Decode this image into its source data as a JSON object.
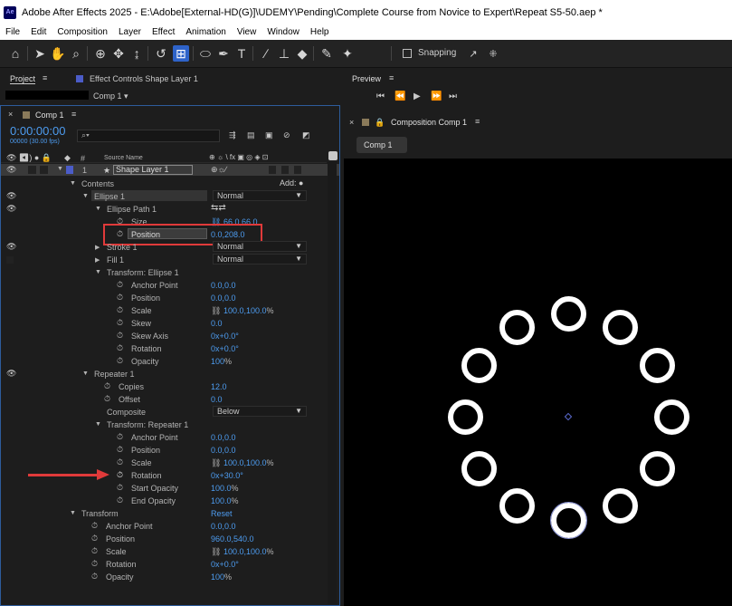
{
  "window": {
    "app_icon": "Ae",
    "title": "Adobe After Effects 2025 - E:\\Adobe[External-HD(G)]\\UDEMY\\Pending\\Complete Course from Novice to Expert\\Repeat S5-50.aep *"
  },
  "menu": [
    "File",
    "Edit",
    "Composition",
    "Layer",
    "Effect",
    "Animation",
    "View",
    "Window",
    "Help"
  ],
  "toolbar": {
    "snapping_label": "Snapping",
    "tools": [
      "home-icon",
      "selection-icon",
      "hand-icon",
      "zoom-icon",
      "orbit-icon",
      "track-xy-icon",
      "track-z-icon",
      "rotate-icon",
      "pan-behind-icon",
      "ellipse-icon",
      "pen-icon",
      "type-icon",
      "brush-icon",
      "clone-stamp-icon",
      "eraser-icon",
      "roto-brush-icon",
      "puppet-pin-icon"
    ]
  },
  "project_panel": {
    "tab_project": "Project",
    "tab_effect_controls": "Effect Controls Shape Layer 1",
    "breadcrumb": "Comp 1"
  },
  "timeline": {
    "tab": "Comp 1",
    "timecode": "0:00:00:00",
    "frames": "00000 (30.00 fps)",
    "search_placeholder": "",
    "header_num": "#",
    "header_source": "Source Name",
    "layer_number": "1",
    "layer_name": "Shape Layer 1",
    "rows": {
      "contents": "Contents",
      "add": "Add:",
      "ellipse1": "Ellipse 1",
      "ellipse1_mode": "Normal",
      "ellipse_path": "Ellipse Path 1",
      "size": "Size",
      "size_val": "66.0,66.0",
      "position": "Position",
      "position_val": "0.0,208.0",
      "stroke": "Stroke 1",
      "stroke_mode": "Normal",
      "fill": "Fill 1",
      "fill_mode": "Normal",
      "transform_ellipse": "Transform: Ellipse 1",
      "repeater": "Repeater 1",
      "copies": "Copies",
      "copies_val": "12.0",
      "offset": "Offset",
      "offset_val": "0.0",
      "composite": "Composite",
      "composite_val": "Below",
      "transform_repeater": "Transform: Repeater 1",
      "start_opacity": "Start Opacity",
      "end_opacity": "End Opacity",
      "transform": "Transform",
      "reset": "Reset"
    },
    "te": {
      "anchor": "Anchor Point",
      "anchor_val": "0.0,0.0",
      "position": "Position",
      "position_val": "0.0,0.0",
      "scale": "Scale",
      "scale_val": "100.0,100.0",
      "pct": "%",
      "skew": "Skew",
      "skew_val": "0.0",
      "skew_axis": "Skew Axis",
      "skew_axis_val": "0x+0.0°",
      "rotation": "Rotation",
      "rotation_val": "0x+0.0°",
      "opacity": "Opacity",
      "opacity_val": "100"
    },
    "tr": {
      "anchor_val": "0.0,0.0",
      "position_val": "0.0,0.0",
      "scale_val": "100.0,100.0",
      "rotation_val": "0x+30.0°",
      "start_opacity_val": "100.0",
      "end_opacity_val": "100.0"
    },
    "tl": {
      "anchor_val": "0.0,0.0",
      "position_val": "960.0,540.0",
      "scale_val": "100.0,100.0",
      "rotation_val": "0x+0.0°",
      "opacity_val": "100"
    }
  },
  "preview": {
    "tab": "Preview"
  },
  "composition": {
    "tab": "Composition Comp 1",
    "sub_tab": "Comp 1",
    "copies": 12,
    "rotation_step_deg": 30
  },
  "colors": {
    "highlight": "#e03a3a",
    "value_blue": "#4d9cf0",
    "accent": "#2e63c9"
  }
}
